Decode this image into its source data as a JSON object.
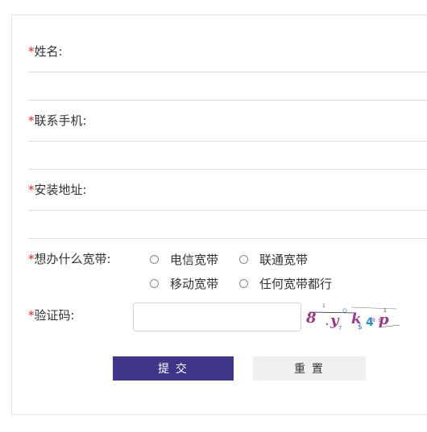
{
  "form": {
    "required_mark": "*",
    "name": {
      "label": "姓名:",
      "value": ""
    },
    "phone": {
      "label": "联系手机:",
      "value": ""
    },
    "address": {
      "label": "安装地址:",
      "value": ""
    },
    "broadband": {
      "label": "想办什么宽带:",
      "options": [
        "电信宽带",
        "联通宽带",
        "移动宽带",
        "任何宽带都行"
      ],
      "selected": null
    },
    "captcha": {
      "label": "验证码:",
      "value": "",
      "image_text": "8yk4p"
    }
  },
  "buttons": {
    "submit": "提 交",
    "reset": "重 置"
  },
  "colors": {
    "accent": "#3f3689",
    "required": "#e2231a",
    "reset_bg": "#f0f0f0"
  }
}
